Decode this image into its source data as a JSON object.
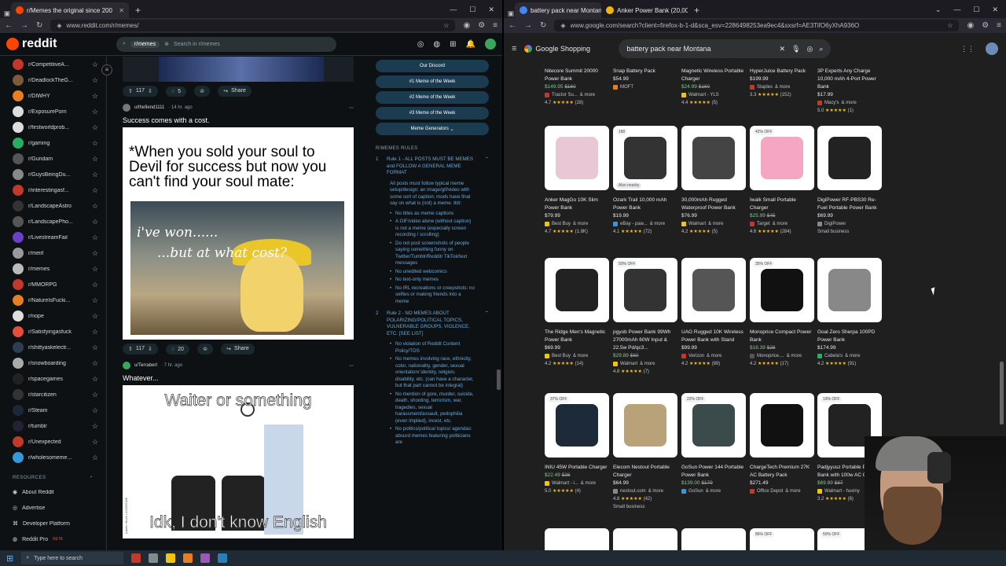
{
  "left_browser": {
    "tabs": [
      {
        "label": "r/Memes the original since 200",
        "active": true
      }
    ],
    "url": "www.reddit.com/r/memes/"
  },
  "reddit": {
    "logo": "reddit",
    "search_chip": "r/memes",
    "search_placeholder": "Search in r/memes",
    "sidebar": [
      {
        "name": "r/CompetitiveA...",
        "color": "#c0392b"
      },
      {
        "name": "r/DeadlockTheG...",
        "color": "#7d5a3c"
      },
      {
        "name": "r/DIWHY",
        "color": "#e67e22"
      },
      {
        "name": "r/ExposurePorn",
        "color": "#ddd"
      },
      {
        "name": "r/firstworldprob...",
        "color": "#ddd"
      },
      {
        "name": "r/gaming",
        "color": "#27ae60"
      },
      {
        "name": "r/Gundam",
        "color": "#555"
      },
      {
        "name": "r/GuysBeingDu...",
        "color": "#888"
      },
      {
        "name": "r/interestingasf...",
        "color": "#c0392b"
      },
      {
        "name": "r/LandscapeAstro",
        "color": "#333"
      },
      {
        "name": "r/LandscapePho...",
        "color": "#555"
      },
      {
        "name": "r/LivestreamFail",
        "color": "#6c3fc9"
      },
      {
        "name": "r/meirl",
        "color": "#999"
      },
      {
        "name": "r/memes",
        "color": "#bbb"
      },
      {
        "name": "r/MMORPG",
        "color": "#c0392b"
      },
      {
        "name": "r/NatureIsFucki...",
        "color": "#e67e22"
      },
      {
        "name": "r/nope",
        "color": "#ddd"
      },
      {
        "name": "r/Satisfyingasfuck",
        "color": "#e74c3c"
      },
      {
        "name": "r/shittyaskelectr...",
        "color": "#2c3e50"
      },
      {
        "name": "r/snowboarding",
        "color": "#aaa"
      },
      {
        "name": "r/spacegames",
        "color": "#222"
      },
      {
        "name": "r/starcitizen",
        "color": "#333"
      },
      {
        "name": "r/Steam",
        "color": "#1b2838"
      },
      {
        "name": "r/tumblr",
        "color": "#223"
      },
      {
        "name": "r/Unexpected",
        "color": "#c0392b"
      },
      {
        "name": "r/wholesomeme...",
        "color": "#3498db"
      }
    ],
    "resources_heading": "RESOURCES",
    "resources": [
      "About Reddit",
      "Advertise",
      "Developer Platform",
      "Reddit Pro"
    ],
    "reddit_pro_badge": "BETA",
    "post0_actions": {
      "votes": "117",
      "comments": "5",
      "share": "Share"
    },
    "post1": {
      "user": "u/thefiend1111",
      "time": "· 14 hr. ago",
      "title": "Success comes with a cost.",
      "caption": "*When you sold your soul to Devil for success but now you can't find your soul mate:",
      "line1": "i've won......",
      "line2": "...but at what cost?",
      "votes": "117",
      "comments": "20",
      "share": "Share"
    },
    "post2": {
      "user": "u/Terrabert",
      "time": "· 7 hr. ago",
      "title": "Whatever...",
      "top_text": "Waiter or something",
      "bottom_text": "Idk, I don't know English",
      "watermark": "Adobe Stock | #24595488"
    },
    "rules_buttons": [
      "Our Discord",
      "#1 Meme of the Week",
      "#2 Meme of the Week",
      "#3 Meme of the Week",
      "Meme Generators"
    ],
    "rules_heading": "R/MEMES RULES",
    "rule1_title": "Rule 1 - ALL POSTS MUST BE MEMES and FOLLOW A GENERAL MEME FORMAT",
    "rule1_desc": "All posts must follow typical meme setup/design: an image/gif/video with some sort of caption; mods have final say on what is (not) a meme. tldr:",
    "rule1_items": [
      "No titles as meme captions",
      "A GIF/video alone (without caption) is not a meme (especially screen recording / scrolling)",
      "Do not post screenshots of people saying something funny on Twitter/Tumblr/Reddit/ TikTok/text messages",
      "No unedited webcomics",
      "No text-only memes",
      "No IRL recreations or creepshots: no selfies or making friends into a meme"
    ],
    "rule2_title": "Rule 2 - NO MEMES ABOUT POLARIZING/POLITICAL TOPICS, VULNERABLE GROUPS, VIOLENCE, ETC. [SEE LIST]",
    "rule2_items": [
      "No violation of Reddit Content Policy/TOS",
      "No memes involving race, ethnicity, color, nationality, gender, sexual orientation/ identity, religion, disability, etc. (can have a character, but that part cannot be integral)",
      "No mention of gore, murder, suicide, death, shooting, terrorism, war, tragedies, sexual harassment/assault, pedophilia (even implied), incest, etc.",
      "No politics/political topics/ agendas: absurd memes featuring politicians are"
    ]
  },
  "right_browser": {
    "tabs": [
      {
        "label": "battery pack near Montana - G",
        "active": true
      },
      {
        "label": "Anker Power Bank (20,000mAh",
        "active": false
      }
    ],
    "url": "www.google.com/search?client=firefox-b-1-d&sca_esv=2286498253ea9ec4&sxsrf=AE3TifO6yXhA936O"
  },
  "google": {
    "logo": "Google Shopping",
    "query": "battery pack near Montana",
    "rows": [
      [
        {
          "name": "Nitecore Summit 20000 Power Bank",
          "price": "$149.95",
          "old": "$160",
          "store": "Tractor Su...",
          "more": "& more",
          "rating": "4.7",
          "count": "(28)",
          "color": "#c0392b"
        },
        {
          "name": "Snap Battery Pack",
          "price": "$54.99",
          "old": "",
          "store": "MOFT",
          "more": "",
          "rating": "",
          "count": "",
          "color": "#e67e22"
        },
        {
          "name": "Magnetic Wireless Portable Charger",
          "price": "$24.99",
          "old": "$160",
          "store": "Walmart - YLS",
          "more": "",
          "rating": "4.4",
          "count": "(5)",
          "color": "#f1c40f"
        },
        {
          "name": "HyperJuice Battery Pack",
          "price": "$199.99",
          "old": "",
          "store": "Staples",
          "more": "& more",
          "rating": "3.3",
          "count": "(152)",
          "color": "#c0392b"
        },
        {
          "name": "3P Experts Any Charge 10,000 mAh 4-Port Power Bank",
          "price": "$17.99",
          "old": "",
          "store": "Macy's",
          "more": "& more",
          "rating": "5.0",
          "count": "(1)",
          "color": "#c0392b"
        }
      ],
      [
        {
          "name": "Anker MagGo 10K Slim Power Bank",
          "price": "$79.99",
          "old": "",
          "store": "Best Buy",
          "more": "& more",
          "rating": "4.7",
          "count": "(1.8K)",
          "color": "#f1c40f",
          "badge": "",
          "near": "",
          "prod": "#e9c7d5"
        },
        {
          "name": "Ozark Trail 10,000 mAh Power Bank",
          "price": "$19.99",
          "old": "",
          "store": "eBay - paw...",
          "more": "& more",
          "rating": "4.1",
          "count": "(72)",
          "color": "#3498db",
          "badge": "180",
          "near": "Also nearby",
          "prod": "#333"
        },
        {
          "name": "30,000mAh Rugged Waterproof Power Bank",
          "price": "$76.99",
          "old": "",
          "store": "Walmart",
          "more": "& more",
          "rating": "4.2",
          "count": "(5)",
          "color": "#f1c40f",
          "badge": "",
          "near": "",
          "prod": "#444"
        },
        {
          "name": "Iwalk Small Portable Charger",
          "price": "$25.99",
          "old": "$45",
          "store": "Target",
          "more": "& more",
          "rating": "4.6",
          "count": "(284)",
          "color": "#c0392b",
          "badge": "42% OFF",
          "near": "",
          "prod": "#f4a6c3"
        },
        {
          "name": "DigiPower RF-PBS30 Re-Fuel Portable Power Bank",
          "price": "$69.99",
          "old": "",
          "store": "DigiPower",
          "more": "",
          "rating": "",
          "count": "",
          "color": "#888",
          "sub": "Small business",
          "badge": "",
          "near": "",
          "prod": "#222"
        }
      ],
      [
        {
          "name": "The Ridge Men's Magnetic Power Bank",
          "price": "$69.99",
          "old": "",
          "store": "Best Buy",
          "more": "& more",
          "rating": "4.2",
          "count": "(14)",
          "color": "#f1c40f",
          "badge": "",
          "near": "",
          "prod": "#222"
        },
        {
          "name": "pgyob Power Bank 99Wh 27000mAh 60W Input & 22.5w Pd/qc3...",
          "price": "$29.89",
          "old": "$60",
          "store": "Walmart",
          "more": "& more",
          "rating": "4.8",
          "count": "(7)",
          "color": "#f1c40f",
          "badge": "50% OFF",
          "near": "",
          "prod": "#333"
        },
        {
          "name": "UAG Rugged 10K Wireless Power Bank with Stand",
          "price": "$99.99",
          "old": "",
          "store": "Verizon",
          "more": "& more",
          "rating": "4.2",
          "count": "(89)",
          "color": "#c0392b",
          "badge": "",
          "near": "",
          "prod": "#555"
        },
        {
          "name": "Monoprice Compact Power Bank",
          "price": "$18.39",
          "old": "$28",
          "store": "Monoprice....",
          "more": "& more",
          "rating": "4.2",
          "count": "(17)",
          "color": "#555",
          "badge": "35% OFF",
          "near": "",
          "prod": "#111"
        },
        {
          "name": "Goal Zero Sherpa 100PD Power Bank",
          "price": "$174.99",
          "old": "",
          "store": "Cabela's",
          "more": "& more",
          "rating": "4.2",
          "count": "(91)",
          "color": "#27ae60",
          "badge": "",
          "near": "",
          "prod": "#888"
        }
      ],
      [
        {
          "name": "INIU 45W Portable Charger",
          "price": "$22.49",
          "old": "$36",
          "store": "Walmart - i...",
          "more": "& more",
          "rating": "5.0",
          "count": "(4)",
          "color": "#f1c40f",
          "badge": "37% OFF",
          "near": "",
          "prod": "#1c2a3a"
        },
        {
          "name": "Elecom Nestout Portable Charger",
          "price": "$64.99",
          "old": "",
          "store": "nestout.com",
          "more": "& more",
          "rating": "4.8",
          "count": "(42)",
          "color": "#888",
          "sub": "Small business",
          "badge": "",
          "near": "",
          "prod": "#b9a27a"
        },
        {
          "name": "GoSun Power 144 Portable Power Bank",
          "price": "$139.00",
          "old": "$179",
          "store": "GoSun",
          "more": "& more",
          "rating": "",
          "count": "",
          "color": "#3498db",
          "badge": "22% OFF",
          "near": "",
          "prod": "#3b4a4a"
        },
        {
          "name": "ChargeTech Premium 27K AC Battery Pack",
          "price": "$271.49",
          "old": "",
          "store": "Office Depot",
          "more": "& more",
          "rating": "",
          "count": "",
          "color": "#c0392b",
          "badge": "",
          "near": "",
          "prod": "#111"
        },
        {
          "name": "Padjyyusz Portable Power Bank with 100w AC Outlet",
          "price": "$69.89",
          "old": "$87",
          "store": "Walmart - huxiny",
          "more": "",
          "rating": "3.2",
          "count": "(6)",
          "color": "#f1c40f",
          "badge": "19% OFF",
          "near": "",
          "prod": "#222"
        }
      ]
    ],
    "row5_badges": [
      "",
      "",
      "",
      "86% OFF",
      "50% OFF"
    ]
  },
  "taskbar": {
    "search": "Type here to search"
  }
}
